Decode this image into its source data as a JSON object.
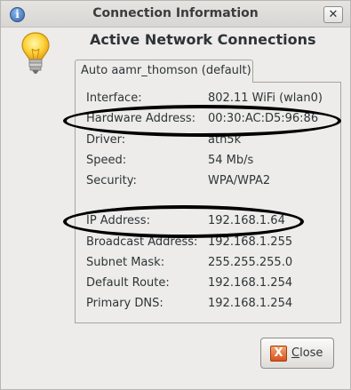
{
  "window": {
    "title": "Connection Information",
    "close_glyph": "✕",
    "info_glyph": "i",
    "icon": "info-icon"
  },
  "header": {
    "icon": "lightbulb-icon",
    "heading": "Active Network Connections"
  },
  "tab": {
    "label": "Auto aamr_thomson (default)"
  },
  "details": [
    {
      "label": "Interface:",
      "value": "802.11 WiFi (wlan0)"
    },
    {
      "label": "Hardware Address:",
      "value": "00:30:AC:D5:96:86"
    },
    {
      "label": "Driver:",
      "value": "ath5k"
    },
    {
      "label": "Speed:",
      "value": "54 Mb/s"
    },
    {
      "label": "Security:",
      "value": "WPA/WPA2"
    },
    {
      "label": "IP Address:",
      "value": "192.168.1.64"
    },
    {
      "label": "Broadcast Address:",
      "value": "192.168.1.255"
    },
    {
      "label": "Subnet Mask:",
      "value": "255.255.255.0"
    },
    {
      "label": "Default Route:",
      "value": "192.168.1.254"
    },
    {
      "label": "Primary DNS:",
      "value": "192.168.1.254"
    }
  ],
  "footer": {
    "close_button": {
      "icon": "close-icon",
      "glyph": "X",
      "mnemonic": "C",
      "rest": "lose"
    }
  },
  "colors": {
    "annotation_ellipse": "#000000",
    "close_button_icon": "#e46a2d",
    "info_icon": "#3465a4"
  }
}
